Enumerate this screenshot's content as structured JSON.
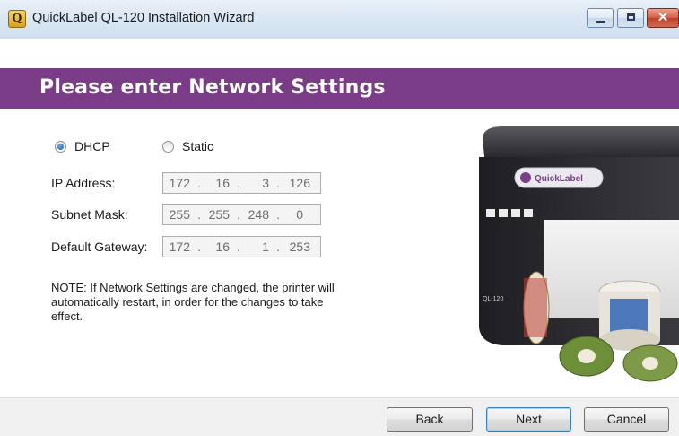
{
  "window": {
    "title": "QuickLabel QL-120 Installation Wizard",
    "app_icon_letter": "Q",
    "close_glyph": "✕"
  },
  "header": {
    "title": "Please enter Network Settings",
    "color": "#7b3c87"
  },
  "network_mode": {
    "options": [
      {
        "label": "DHCP",
        "checked": true
      },
      {
        "label": "Static",
        "checked": false
      }
    ]
  },
  "fields": {
    "ip_address": {
      "label": "IP Address:",
      "octets": [
        "172",
        "16",
        "3",
        "126"
      ]
    },
    "subnet_mask": {
      "label": "Subnet Mask:",
      "octets": [
        "255",
        "255",
        "248",
        "0"
      ]
    },
    "default_gateway": {
      "label": "Default Gateway:",
      "octets": [
        "172",
        "16",
        "1",
        "253"
      ]
    }
  },
  "note": "NOTE: If Network Settings are changed, the printer will automatically restart, in order for the changes to take effect.",
  "printer": {
    "brand": "QuickLabel",
    "model": "QL-120"
  },
  "footer": {
    "back_label": "Back",
    "next_label": "Next",
    "cancel_label": "Cancel"
  }
}
